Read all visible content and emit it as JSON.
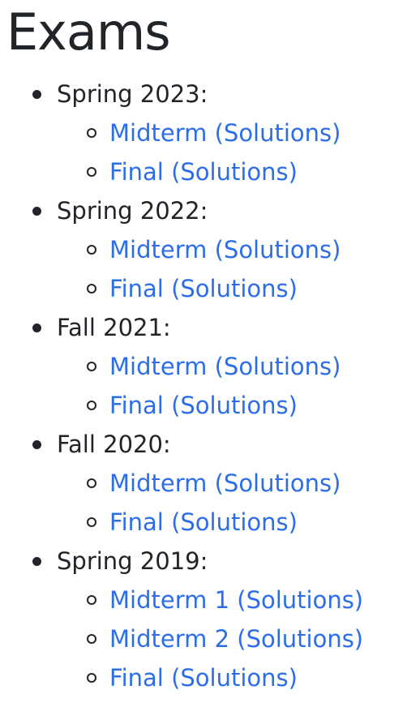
{
  "page": {
    "title": "Exams"
  },
  "terms": [
    {
      "label": "Spring 2023:",
      "exams": [
        {
          "name": "Midterm",
          "solutions": "(Solutions)"
        },
        {
          "name": "Final",
          "solutions": "(Solutions)"
        }
      ]
    },
    {
      "label": "Spring 2022:",
      "exams": [
        {
          "name": "Midterm",
          "solutions": "(Solutions)"
        },
        {
          "name": "Final",
          "solutions": "(Solutions)"
        }
      ]
    },
    {
      "label": "Fall 2021:",
      "exams": [
        {
          "name": "Midterm",
          "solutions": "(Solutions)"
        },
        {
          "name": "Final",
          "solutions": "(Solutions)"
        }
      ]
    },
    {
      "label": "Fall 2020:",
      "exams": [
        {
          "name": "Midterm",
          "solutions": "(Solutions)"
        },
        {
          "name": "Final",
          "solutions": "(Solutions)"
        }
      ]
    },
    {
      "label": "Spring 2019:",
      "exams": [
        {
          "name": "Midterm 1",
          "solutions": "(Solutions)"
        },
        {
          "name": "Midterm 2",
          "solutions": "(Solutions)"
        },
        {
          "name": "Final",
          "solutions": "(Solutions)"
        }
      ]
    }
  ],
  "colors": {
    "text": "#212529",
    "link": "#2d6ee6",
    "background": "#ffffff"
  },
  "icons": {
    "term_bullet": "filled-disc-bullet-icon",
    "exam_bullet": "hollow-circle-bullet-icon"
  }
}
